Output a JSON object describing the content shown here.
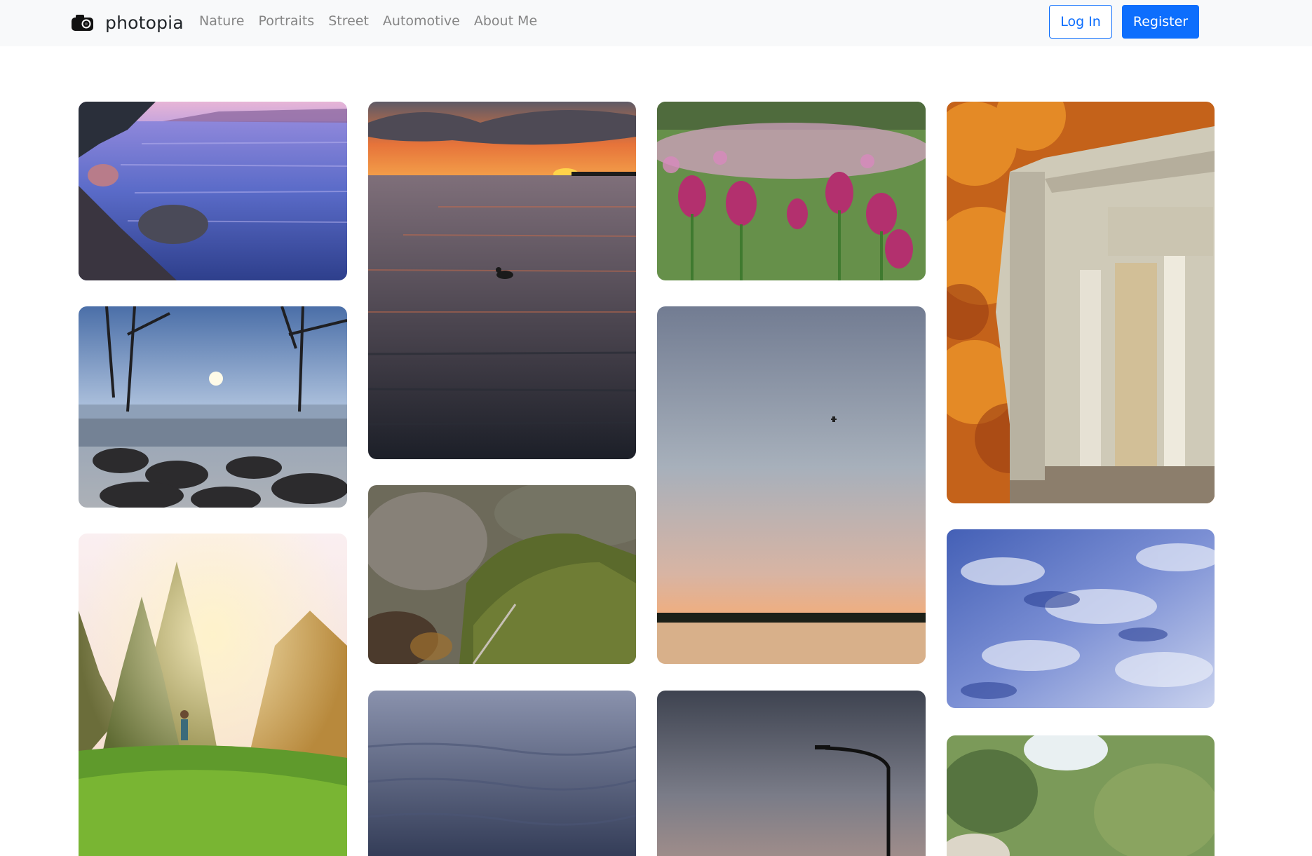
{
  "navbar": {
    "brand_name": "photopia",
    "brand_icon": "camera-icon",
    "links": [
      "Nature",
      "Portraits",
      "Street",
      "Automotive",
      "About Me"
    ],
    "login_label": "Log In",
    "register_label": "Register"
  },
  "colors": {
    "accent": "#0d6efd",
    "navbar_bg": "#f8f9fa",
    "nav_link": "#858585"
  }
}
